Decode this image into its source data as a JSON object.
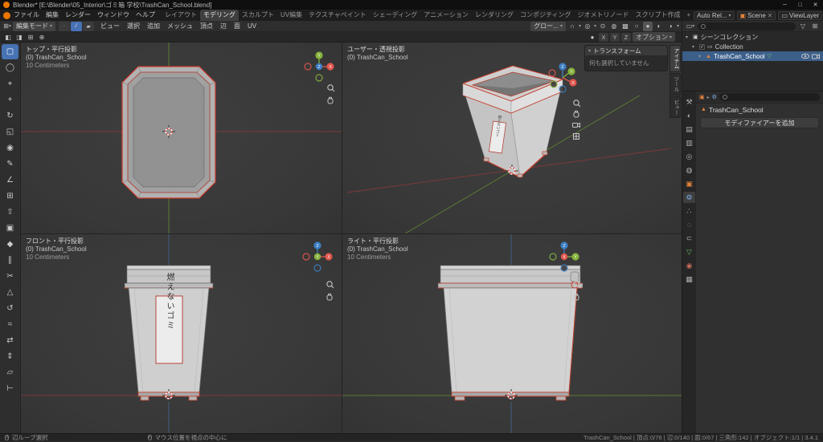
{
  "titlebar": {
    "title": "Blender* [E:\\Blender\\05_Interior\\ゴミ箱 学校\\TrashCan_School.blend]",
    "minimize": "─",
    "maximize": "□",
    "close": "✕"
  },
  "menubar": {
    "menus": [
      "ファイル",
      "編集",
      "レンダー",
      "ウィンドウ",
      "ヘルプ"
    ],
    "workspaces": [
      "レイアウト",
      "モデリング",
      "スカルプト",
      "UV編集",
      "テクスチャペイント",
      "シェーディング",
      "アニメーション",
      "レンダリング",
      "コンポジティング",
      "ジオメトリノード",
      "スクリプト作成",
      "+"
    ],
    "auto_save": "Auto Rel...",
    "scene": "Scene",
    "viewlayer": "ViewLayer"
  },
  "header": {
    "mode": "編集モード",
    "menus": [
      "ビュー",
      "選択",
      "追加",
      "メッシュ",
      "頂点",
      "辺",
      "面",
      "UV"
    ],
    "orientation": "グロー...",
    "options_label": "オプション",
    "axes": [
      "X",
      "Y",
      "Z"
    ]
  },
  "viewports": {
    "top": {
      "view": "トップ・平行投影",
      "object": "(0) TrashCan_School",
      "unit": "10 Centimeters"
    },
    "user": {
      "view": "ユーザー・透視投影",
      "object": "(0) TrashCan_School"
    },
    "front": {
      "view": "フロント・平行投影",
      "object": "(0) TrashCan_School",
      "unit": "10 Centimeters"
    },
    "right": {
      "view": "ライト・平行投影",
      "object": "(0) TrashCan_School",
      "unit": "10 Centimeters"
    }
  },
  "npanel": {
    "title": "トランスフォーム",
    "message": "何も選択していません",
    "tabs": [
      "アイテム",
      "ツール",
      "ビュー"
    ]
  },
  "model": {
    "label_text": "燃えないゴミ"
  },
  "outliner": {
    "scene_collection": "シーンコレクション",
    "collection": "Collection",
    "object": "TrashCan_School"
  },
  "properties": {
    "object_name": "TrashCan_School",
    "add_modifier": "モディファイアーを追加"
  },
  "toolbar": {
    "tools": [
      {
        "name": "select-box",
        "glyph": "▢"
      },
      {
        "name": "select-circle",
        "glyph": "◯"
      },
      {
        "name": "cursor",
        "glyph": "⌖"
      },
      {
        "name": "move",
        "glyph": "+"
      },
      {
        "name": "rotate",
        "glyph": "↻"
      },
      {
        "name": "scale",
        "glyph": "◱"
      },
      {
        "name": "transform",
        "glyph": "◉"
      },
      {
        "name": "annotate",
        "glyph": "✎"
      },
      {
        "name": "measure",
        "glyph": "∠"
      },
      {
        "name": "add-cube",
        "glyph": "⊞"
      },
      {
        "name": "extrude-region",
        "glyph": "⇧"
      },
      {
        "name": "inset-faces",
        "glyph": "▣"
      },
      {
        "name": "bevel",
        "glyph": "◆"
      },
      {
        "name": "loop-cut",
        "glyph": "∥"
      },
      {
        "name": "knife",
        "glyph": "✂"
      },
      {
        "name": "poly-build",
        "glyph": "△"
      },
      {
        "name": "spin",
        "glyph": "↺"
      },
      {
        "name": "smooth",
        "glyph": "≈"
      },
      {
        "name": "edge-slide",
        "glyph": "⇄"
      },
      {
        "name": "shrink-fatten",
        "glyph": "⇕"
      },
      {
        "name": "shear",
        "glyph": "▱"
      },
      {
        "name": "rip-region",
        "glyph": "⊢"
      }
    ]
  },
  "prop_tabs": [
    {
      "name": "tool",
      "glyph": "⚒"
    },
    {
      "name": "render",
      "glyph": "◐"
    },
    {
      "name": "output",
      "glyph": "▤"
    },
    {
      "name": "view-layer",
      "glyph": "▥"
    },
    {
      "name": "scene",
      "glyph": "◎"
    },
    {
      "name": "world",
      "glyph": "◍"
    },
    {
      "name": "object",
      "glyph": "▣"
    },
    {
      "name": "modifiers",
      "glyph": "⚙"
    },
    {
      "name": "particles",
      "glyph": "∴"
    },
    {
      "name": "physics",
      "glyph": "◌"
    },
    {
      "name": "constraints",
      "glyph": "⊂"
    },
    {
      "name": "object-data",
      "glyph": "▽"
    },
    {
      "name": "material",
      "glyph": "◉"
    },
    {
      "name": "texture",
      "glyph": "▦"
    }
  ],
  "icons": {
    "caret_down": "▾",
    "caret_right": "▸",
    "vertex_mode": "∙",
    "edge_mode": "∕",
    "face_mode": "▰",
    "magnet": "∩",
    "proportional": "◎",
    "gizmo": "⊙",
    "overlays": "◍",
    "xray": "▩",
    "wire_sphere": "○",
    "solid_sphere": "●",
    "material_sphere": "◐",
    "render_sphere": "◑",
    "editor_3d": "⊞",
    "check": "✓",
    "mesh": "▲",
    "mesh_data": "▽",
    "collection": "▭",
    "scene_collection": "▣",
    "filter": "▽",
    "new_collection": "⊞",
    "settings": "⚙"
  },
  "statusbar": {
    "hint1": "辺ループ選択",
    "hint2": "マウス位置を視点の中心に",
    "stats": "TrashCan_School | 頂点:0/76 | 辺:0/140 | 面:0/67 | 三角形:142 | オブジェクト:1/1 | 3.4.1"
  }
}
